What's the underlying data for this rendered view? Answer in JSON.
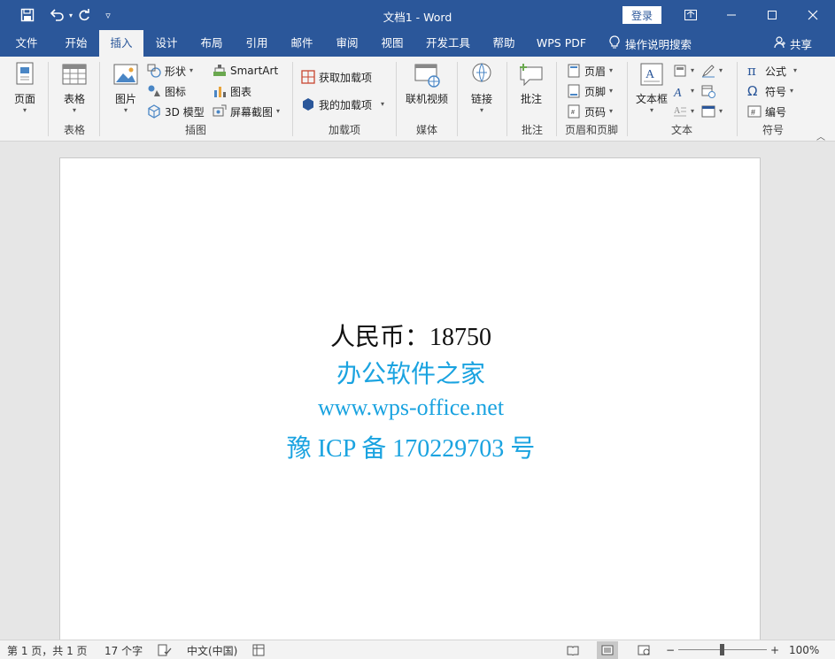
{
  "titlebar": {
    "title": "文档1  -  Word",
    "login_label": "登录"
  },
  "tabs": [
    {
      "label": "文件"
    },
    {
      "label": "开始"
    },
    {
      "label": "插入"
    },
    {
      "label": "设计"
    },
    {
      "label": "布局"
    },
    {
      "label": "引用"
    },
    {
      "label": "邮件"
    },
    {
      "label": "审阅"
    },
    {
      "label": "视图"
    },
    {
      "label": "开发工具"
    },
    {
      "label": "帮助"
    },
    {
      "label": "WPS PDF"
    }
  ],
  "tellme": {
    "label": "操作说明搜索"
  },
  "share": {
    "label": "共享"
  },
  "ribbon": {
    "pages": {
      "button": "页面",
      "group": "表格"
    },
    "table": {
      "button": "表格",
      "group": "表格"
    },
    "illustrations": {
      "picture": "图片",
      "shapes": "形状",
      "icons": "图标",
      "model3d": "3D 模型",
      "smartart": "SmartArt",
      "chart": "图表",
      "screenshot": "屏幕截图",
      "group": "插图"
    },
    "addins": {
      "get": "获取加载项",
      "mine": "我的加载项",
      "group": "加载项"
    },
    "media": {
      "video": "联机视频",
      "group": "媒体"
    },
    "links": {
      "link": "链接"
    },
    "comments": {
      "comment": "批注",
      "group": "批注"
    },
    "header_footer": {
      "header": "页眉",
      "footer": "页脚",
      "page_number": "页码",
      "group": "页眉和页脚"
    },
    "text": {
      "textbox": "文本框",
      "group": "文本"
    },
    "symbols": {
      "equation": "公式",
      "symbol": "符号",
      "number": "编号",
      "group": "符号"
    }
  },
  "document": {
    "line1": "人民币：18750",
    "line2": "办公软件之家",
    "line3": "www.wps-office.net",
    "line4": "豫 ICP 备 170229703 号"
  },
  "status": {
    "page": "第 1 页，共 1 页",
    "words": "17 个字",
    "language": "中文(中国)",
    "zoom": "100%"
  },
  "colors": {
    "brand": "#2b579a",
    "doc_accent": "#1aa3e0"
  }
}
